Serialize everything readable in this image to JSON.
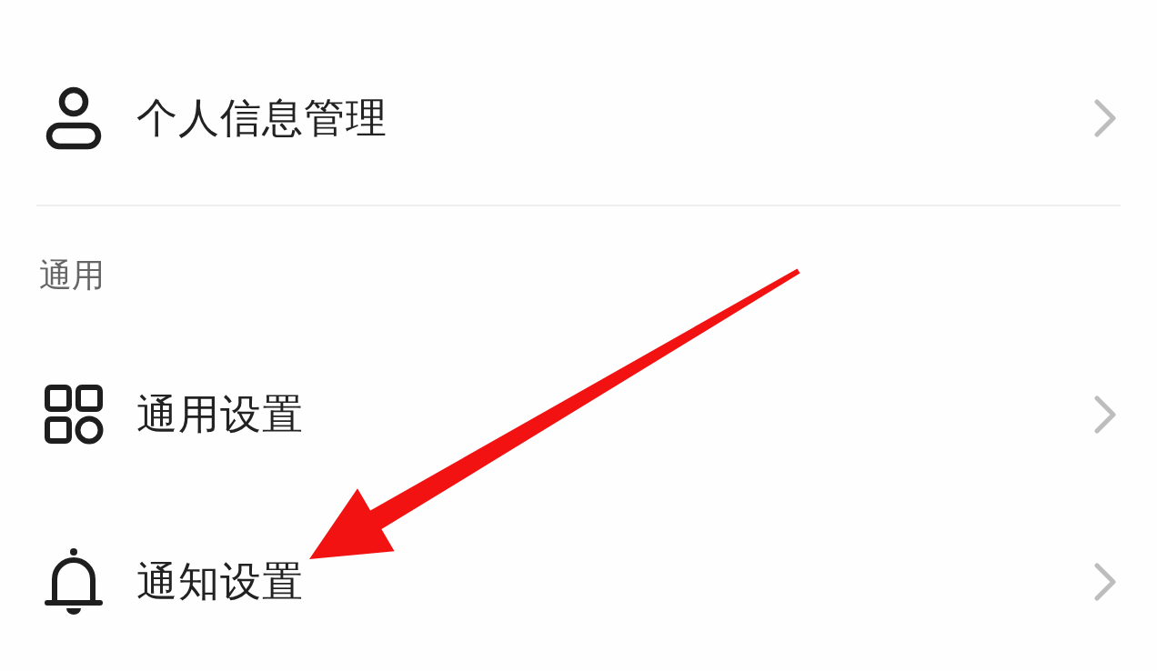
{
  "account_items": [
    {
      "label": "个人信息管理"
    }
  ],
  "sections": [
    {
      "title": "通用",
      "items": [
        {
          "label": "通用设置"
        },
        {
          "label": "通知设置"
        }
      ]
    }
  ]
}
